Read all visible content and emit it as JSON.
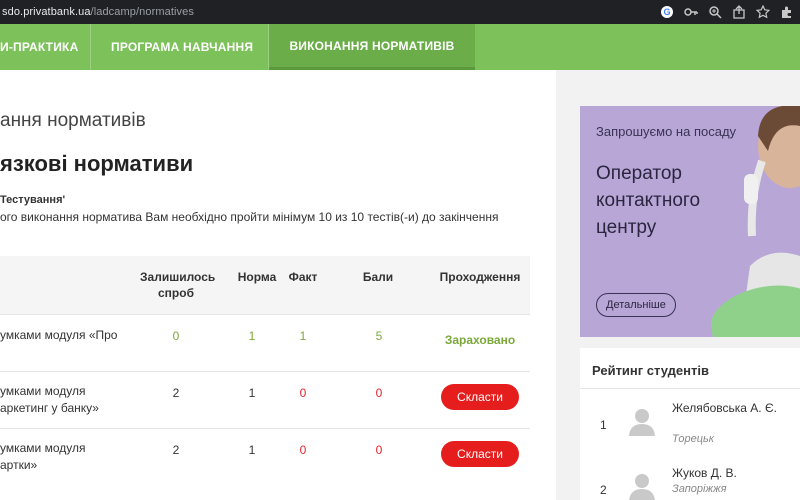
{
  "browser": {
    "url_host": "sdo.privatbank.ua",
    "url_path": "/ladcamp/normatives",
    "icons": [
      "google-icon",
      "key-icon",
      "zoom-icon",
      "share-icon",
      "star-icon",
      "extension-icon"
    ]
  },
  "nav": {
    "tabs": [
      {
        "label": "И-ПРАКТИКА",
        "active": false
      },
      {
        "label": "ПРОГРАМА НАВЧАННЯ",
        "active": false
      },
      {
        "label": "ВИКОНАННЯ НОРМАТИВІВ",
        "active": true
      }
    ]
  },
  "page": {
    "title": "ання нормативів",
    "section_title": "язкові нормативи",
    "test_name": "Тестування'",
    "note": "ого виконання норматива Вам необхідно пройти мінімум 10 из 10 тестів(-и) до закінчення"
  },
  "table": {
    "headers": {
      "attempts": "Залишилось спроб",
      "norm": "Норма",
      "fact": "Факт",
      "points": "Бали",
      "status": "Проходження"
    },
    "rows": [
      {
        "name_line1": "умками модуля «Про",
        "name_line2": "",
        "attempts": "0",
        "norm": "1",
        "fact": "1",
        "points": "5",
        "status": "Зараховано",
        "passed": true
      },
      {
        "name_line1": "умками модуля",
        "name_line2": "аркетинг у банку»",
        "attempts": "2",
        "norm": "1",
        "fact": "0",
        "points": "0",
        "status": "Скласти",
        "passed": false
      },
      {
        "name_line1": "умками модуля",
        "name_line2": "артки»",
        "attempts": "2",
        "norm": "1",
        "fact": "0",
        "points": "0",
        "status": "Скласти",
        "passed": false
      }
    ]
  },
  "ad": {
    "invite": "Запрошуємо на посаду",
    "job_title": "Оператор контактного центру",
    "button": "Детальніше",
    "bg_color": "#b7a6d6"
  },
  "rating": {
    "title": "Рейтинг студентів",
    "students": [
      {
        "rank": "1",
        "name": "Желябовська А. Є.",
        "city": "Торецьк"
      },
      {
        "rank": "2",
        "name": "Жуков Д. В.",
        "city": "Запоріжжя"
      }
    ]
  },
  "colors": {
    "nav_green": "#7cc159",
    "nav_active": "#6aad49",
    "action_red": "#e51d1d",
    "pass_green": "#7aa83a"
  }
}
